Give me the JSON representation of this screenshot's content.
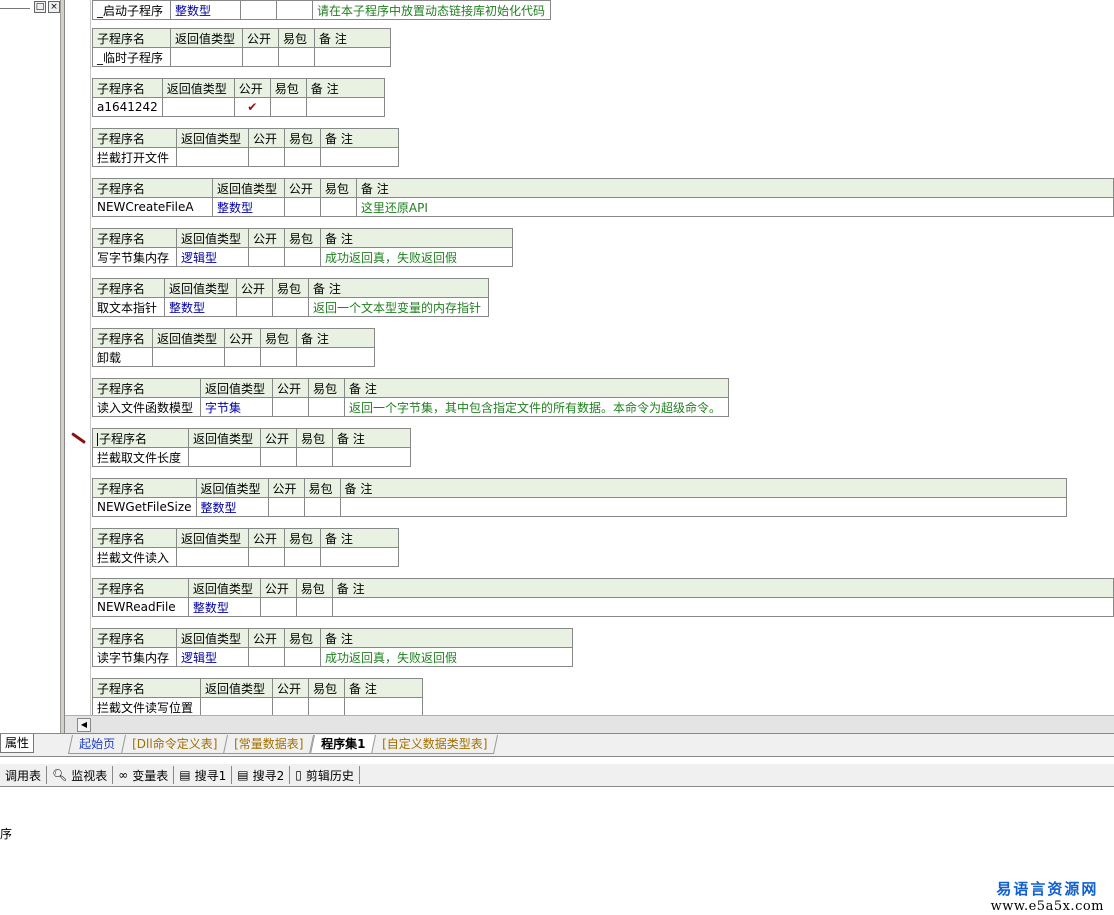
{
  "left_panel": {
    "restore_glyph": "□",
    "close_glyph": "×"
  },
  "headers": {
    "name": "子程序名",
    "ret": "返回值类型",
    "pub": "公开",
    "easy": "易包",
    "note": "备 注"
  },
  "procedures": [
    {
      "name": "_启动子程序",
      "type": "整数型",
      "tick": "",
      "note": "请在本子程序中放置动态链接库初始化代码"
    },
    {
      "name": "_临时子程序",
      "type": "",
      "tick": "",
      "note": ""
    },
    {
      "name": "a1641242",
      "type": "",
      "tick": "✔",
      "note": ""
    },
    {
      "name": "拦截打开文件",
      "type": "",
      "tick": "",
      "note": ""
    },
    {
      "name": "NEWCreateFileA",
      "type": "整数型",
      "tick": "",
      "note": "这里还原API"
    },
    {
      "name": "写字节集内存",
      "type": "逻辑型",
      "tick": "",
      "note": "成功返回真，失败返回假"
    },
    {
      "name": "取文本指针",
      "type": "整数型",
      "tick": "",
      "note": "返回一个文本型变量的内存指针"
    },
    {
      "name": "卸载",
      "type": "",
      "tick": "",
      "note": ""
    },
    {
      "name": "读入文件函数模型",
      "type": "字节集",
      "tick": "",
      "note": "返回一个字节集，其中包含指定文件的所有数据。本命令为超级命令。"
    },
    {
      "name": "拦截取文件长度",
      "type": "",
      "tick": "",
      "note": ""
    },
    {
      "name": "NEWGetFileSize",
      "type": "整数型",
      "tick": "",
      "note": ""
    },
    {
      "name": "拦截文件读入",
      "type": "",
      "tick": "",
      "note": ""
    },
    {
      "name": "NEWReadFile",
      "type": "整数型",
      "tick": "",
      "note": ""
    },
    {
      "name": "读字节集内存",
      "type": "逻辑型",
      "tick": "",
      "note": "成功返回真，失败返回假"
    },
    {
      "name": "拦截文件读写位置",
      "type": "",
      "tick": "",
      "note": ""
    }
  ],
  "tabs": {
    "properties": "属性",
    "start": "起始页",
    "dll": "[Dll命令定义表]",
    "const": "[常量数据表]",
    "program": "程序集1",
    "custom": "[自定义数据类型表]"
  },
  "toolbar": {
    "call": "调用表",
    "monitor": "监视表",
    "vars": "变量表",
    "search1": "搜寻1",
    "search2": "搜寻2",
    "clip": "剪辑历史"
  },
  "status": {
    "text": "序"
  },
  "watermark": {
    "line1": "易语言资源网",
    "line2": "www.e5a5x.com"
  }
}
